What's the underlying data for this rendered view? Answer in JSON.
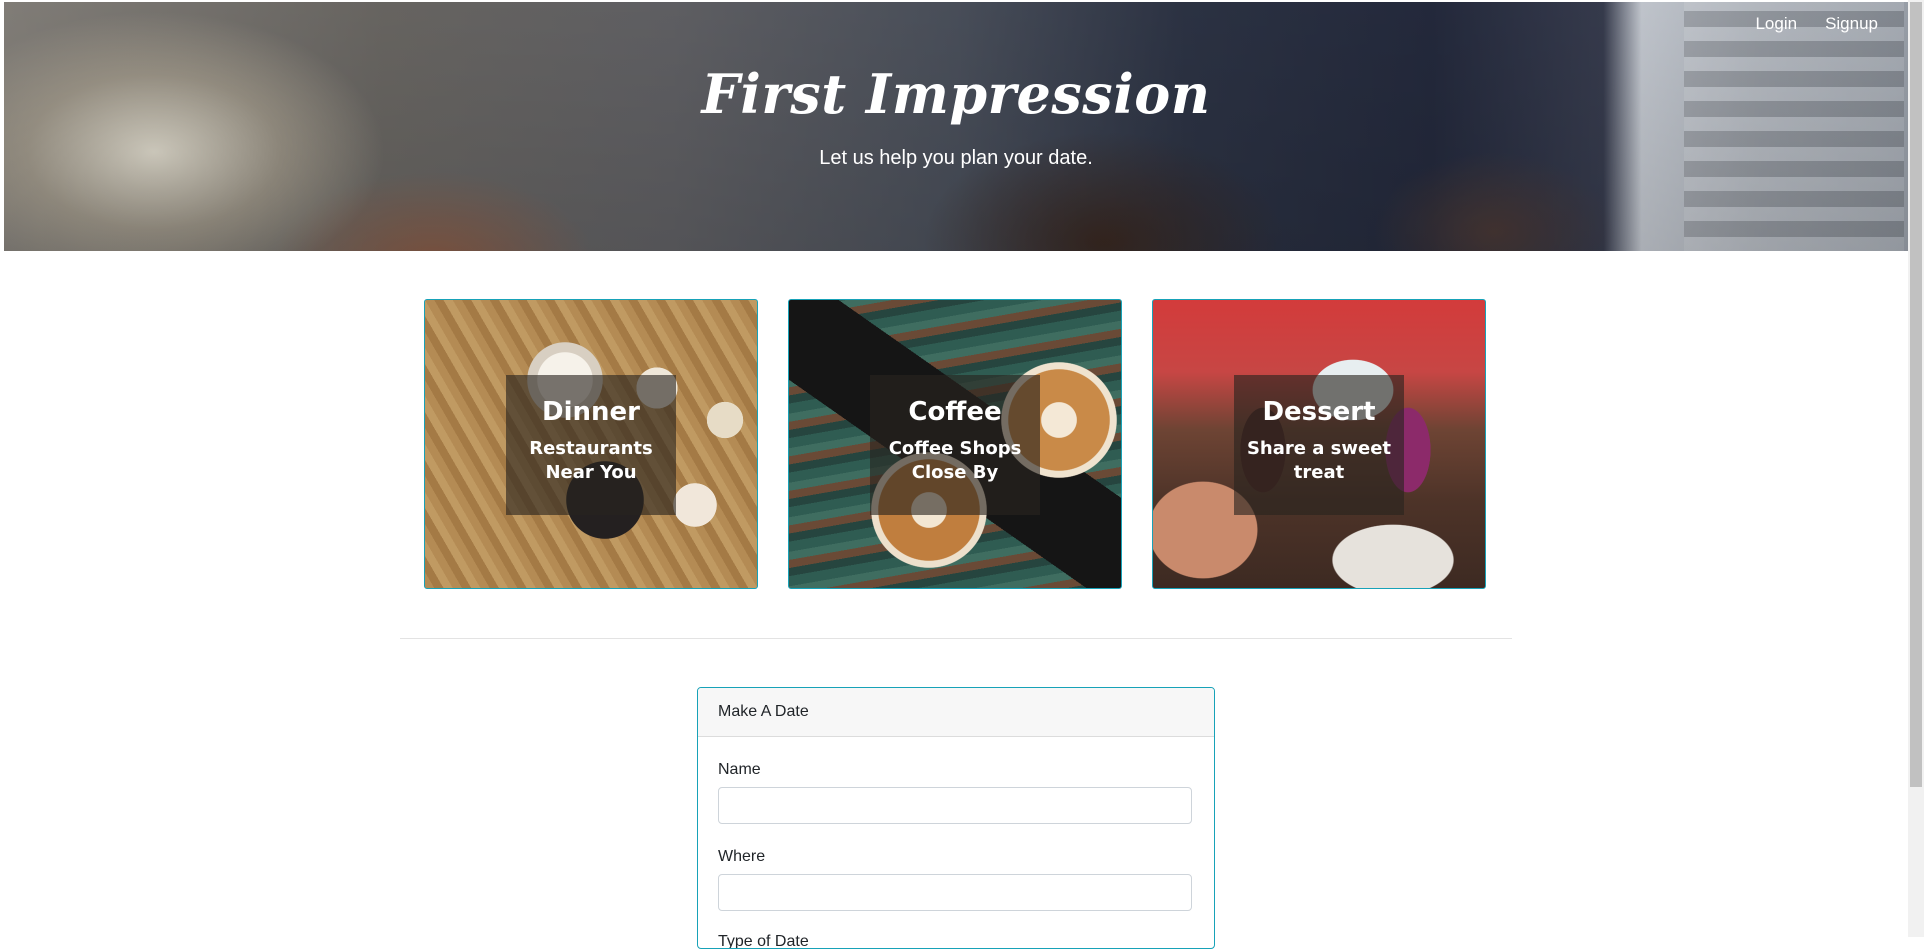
{
  "nav": {
    "login": "Login",
    "signup": "Signup"
  },
  "hero": {
    "title": "First Impression",
    "subtitle": "Let us help you plan your date."
  },
  "cards": [
    {
      "title": "Dinner",
      "subtitle": "Restaurants Near You"
    },
    {
      "title": "Coffee",
      "subtitle": "Coffee Shops Close By"
    },
    {
      "title": "Dessert",
      "subtitle": "Share a sweet treat"
    }
  ],
  "form": {
    "header": "Make A Date",
    "fields": [
      {
        "label": "Name",
        "value": ""
      },
      {
        "label": "Where",
        "value": ""
      },
      {
        "label": "Type of Date"
      }
    ]
  },
  "colors": {
    "accent": "#17a2b8",
    "card_overlay": "#28231e"
  }
}
